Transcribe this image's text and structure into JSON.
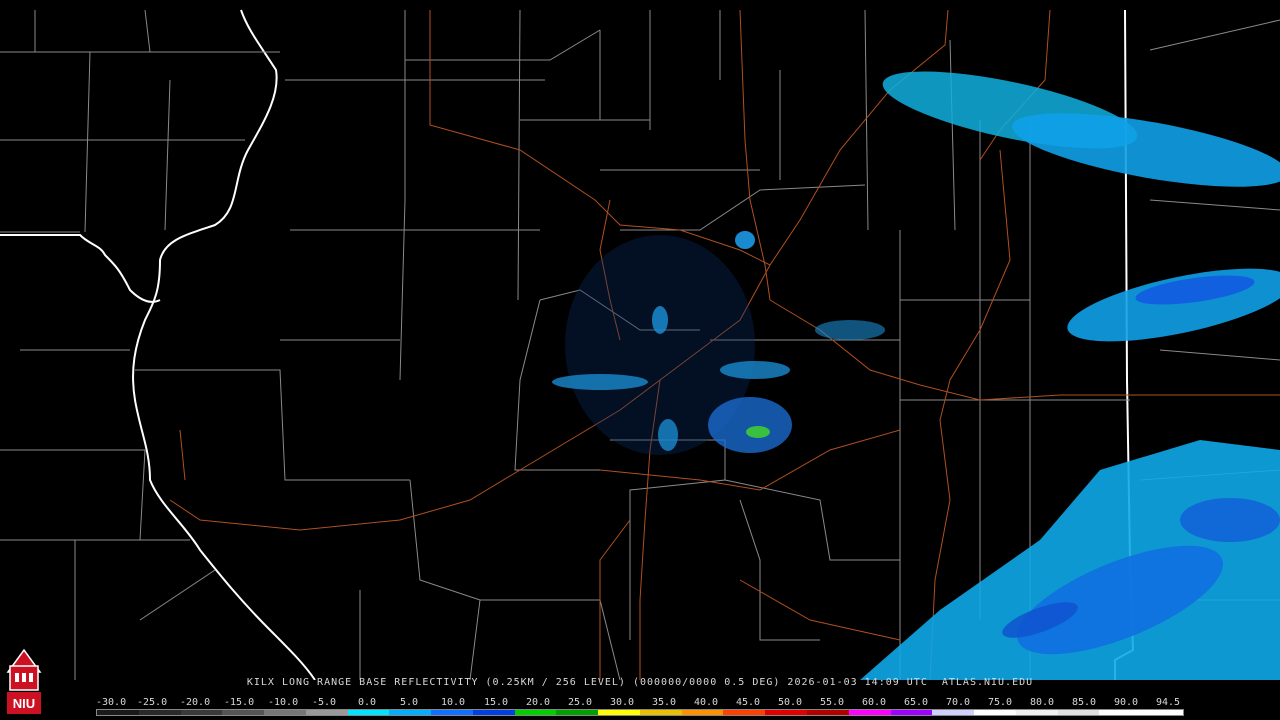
{
  "caption": "KILX LONG RANGE BASE REFLECTIVITY (0.25KM / 256 LEVEL) (000000/0000 0.5 DEG) 2026-01-03 14:09 UTC  ATLAS.NIU.EDU",
  "logo": {
    "text": "NIU",
    "icon": "niu-logo-icon"
  },
  "scale": {
    "labels": [
      "-30.0",
      "-25.0",
      "-20.0",
      "-15.0",
      "-10.0",
      "-5.0",
      "0.0",
      "5.0",
      "10.0",
      "15.0",
      "20.0",
      "25.0",
      "30.0",
      "35.0",
      "40.0",
      "45.0",
      "50.0",
      "55.0",
      "60.0",
      "65.0",
      "70.0",
      "75.0",
      "80.0",
      "85.0",
      "90.0",
      "94.5"
    ],
    "colors": [
      "#1a1a1a",
      "#2a2a2a",
      "#3a3a3a",
      "#555555",
      "#777777",
      "#999999",
      "#00e5ff",
      "#00b0ff",
      "#1070ff",
      "#0040e0",
      "#00d000",
      "#00a000",
      "#ffff00",
      "#e8c000",
      "#ff9000",
      "#ff4000",
      "#e00000",
      "#b00000",
      "#ff00ff",
      "#a000ff",
      "#d0d0ff",
      "#ffffff",
      "#f0f0f0",
      "#e0e0e0",
      "#ffffff",
      "#ffffff"
    ]
  }
}
